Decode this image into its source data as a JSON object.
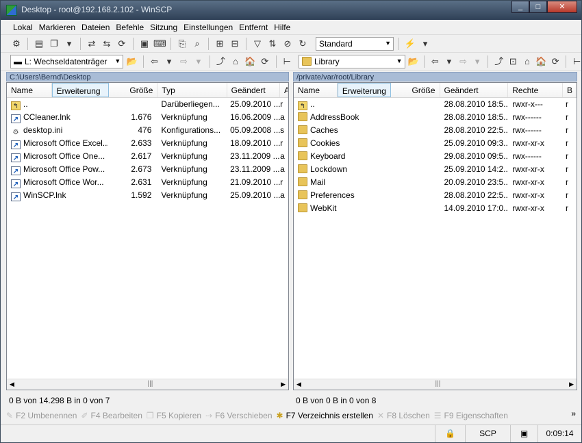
{
  "window": {
    "title": "Desktop - root@192.168.2.102 - WinSCP",
    "buttons": [
      "_",
      "□",
      "✕"
    ]
  },
  "menu": [
    "Lokal",
    "Markieren",
    "Dateien",
    "Befehle",
    "Sitzung",
    "Einstellungen",
    "Entfernt",
    "Hilfe"
  ],
  "toolbar": {
    "preset": "Standard"
  },
  "left": {
    "drive": "L: Wechseldatenträger",
    "path": "C:\\Users\\Bernd\\Desktop",
    "columns": [
      "Name",
      "Erweiterung",
      "Größe",
      "Typ",
      "Geändert",
      "A"
    ],
    "rows": [
      {
        "icon": "up",
        "name": "..",
        "size": "",
        "type": "Darüberliegen...",
        "changed": "25.09.2010 ...",
        "a": "r"
      },
      {
        "icon": "lnk",
        "name": "CCleaner.lnk",
        "size": "1.676",
        "type": "Verknüpfung",
        "changed": "16.06.2009 ...",
        "a": "a"
      },
      {
        "icon": "ini",
        "name": "desktop.ini",
        "size": "476",
        "type": "Konfigurations...",
        "changed": "05.09.2008 ...",
        "a": "s"
      },
      {
        "icon": "lnk",
        "name": "Microsoft Office Excel...",
        "size": "2.633",
        "type": "Verknüpfung",
        "changed": "18.09.2010 ...",
        "a": "r"
      },
      {
        "icon": "lnk",
        "name": "Microsoft Office One...",
        "size": "2.617",
        "type": "Verknüpfung",
        "changed": "23.11.2009 ...",
        "a": "a"
      },
      {
        "icon": "lnk",
        "name": "Microsoft Office Pow...",
        "size": "2.673",
        "type": "Verknüpfung",
        "changed": "23.11.2009 ...",
        "a": "a"
      },
      {
        "icon": "lnk",
        "name": "Microsoft Office Wor...",
        "size": "2.631",
        "type": "Verknüpfung",
        "changed": "21.09.2010 ...",
        "a": "r"
      },
      {
        "icon": "lnk",
        "name": "WinSCP.lnk",
        "size": "1.592",
        "type": "Verknüpfung",
        "changed": "25.09.2010 ...",
        "a": "a"
      }
    ],
    "status": "0 B von 14.298 B in 0 von 7"
  },
  "right": {
    "drive": "Library",
    "path": "/private/var/root/Library",
    "columns": [
      "Name",
      "Erweiterung",
      "Größe",
      "Geändert",
      "Rechte",
      "B"
    ],
    "rows": [
      {
        "icon": "up",
        "name": "..",
        "changed": "28.08.2010 18:5...",
        "rights": "rwxr-x---",
        "b": "r"
      },
      {
        "icon": "folder",
        "name": "AddressBook",
        "changed": "28.08.2010 18:5...",
        "rights": "rwx------",
        "b": "r"
      },
      {
        "icon": "folder",
        "name": "Caches",
        "changed": "28.08.2010 22:5...",
        "rights": "rwx------",
        "b": "r"
      },
      {
        "icon": "folder",
        "name": "Cookies",
        "changed": "25.09.2010 09:3...",
        "rights": "rwxr-xr-x",
        "b": "r"
      },
      {
        "icon": "folder",
        "name": "Keyboard",
        "changed": "29.08.2010 09:5...",
        "rights": "rwx------",
        "b": "r"
      },
      {
        "icon": "folder",
        "name": "Lockdown",
        "changed": "25.09.2010 14:2...",
        "rights": "rwxr-xr-x",
        "b": "r"
      },
      {
        "icon": "folder",
        "name": "Mail",
        "changed": "20.09.2010 23:5...",
        "rights": "rwxr-xr-x",
        "b": "r"
      },
      {
        "icon": "folder",
        "name": "Preferences",
        "changed": "28.08.2010 22:5...",
        "rights": "rwxr-xr-x",
        "b": "r"
      },
      {
        "icon": "folder",
        "name": "WebKit",
        "changed": "14.09.2010 17:0...",
        "rights": "rwxr-xr-x",
        "b": "r"
      }
    ],
    "status": "0 B von 0 B in 0 von 8"
  },
  "fkeys": [
    {
      "label": "F2 Umbenennen",
      "active": false
    },
    {
      "label": "F4 Bearbeiten",
      "active": false
    },
    {
      "label": "F5 Kopieren",
      "active": false
    },
    {
      "label": "F6 Verschieben",
      "active": false
    },
    {
      "label": "F7 Verzeichnis erstellen",
      "active": true
    },
    {
      "label": "F8 Löschen",
      "active": false
    },
    {
      "label": "F9 Eigenschaften",
      "active": false
    }
  ],
  "bottom": {
    "protocol": "SCP",
    "time": "0:09:14"
  }
}
